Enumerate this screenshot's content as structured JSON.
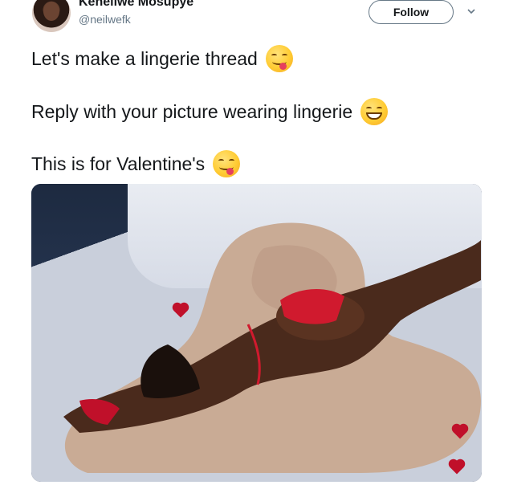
{
  "user": {
    "display_name": "Keneilwe Mosupye",
    "handle": "@neilwefk"
  },
  "follow_button": {
    "label": "Follow"
  },
  "tweet": {
    "lines": [
      {
        "text": "Let's make a lingerie thread",
        "emoji": "face-savoring-food"
      },
      {
        "text": "Reply with your picture wearing lingerie",
        "emoji": "grinning-face-with-smiling-eyes"
      },
      {
        "text": "This is for Valentine's",
        "emoji": "face-savoring-food"
      }
    ]
  },
  "media": {
    "icon": "photo-attachment"
  },
  "colors": {
    "text": "#14171a",
    "secondary_text": "#657786",
    "follow_border": "#657786",
    "emoji_yellow": "#ffcc33"
  }
}
